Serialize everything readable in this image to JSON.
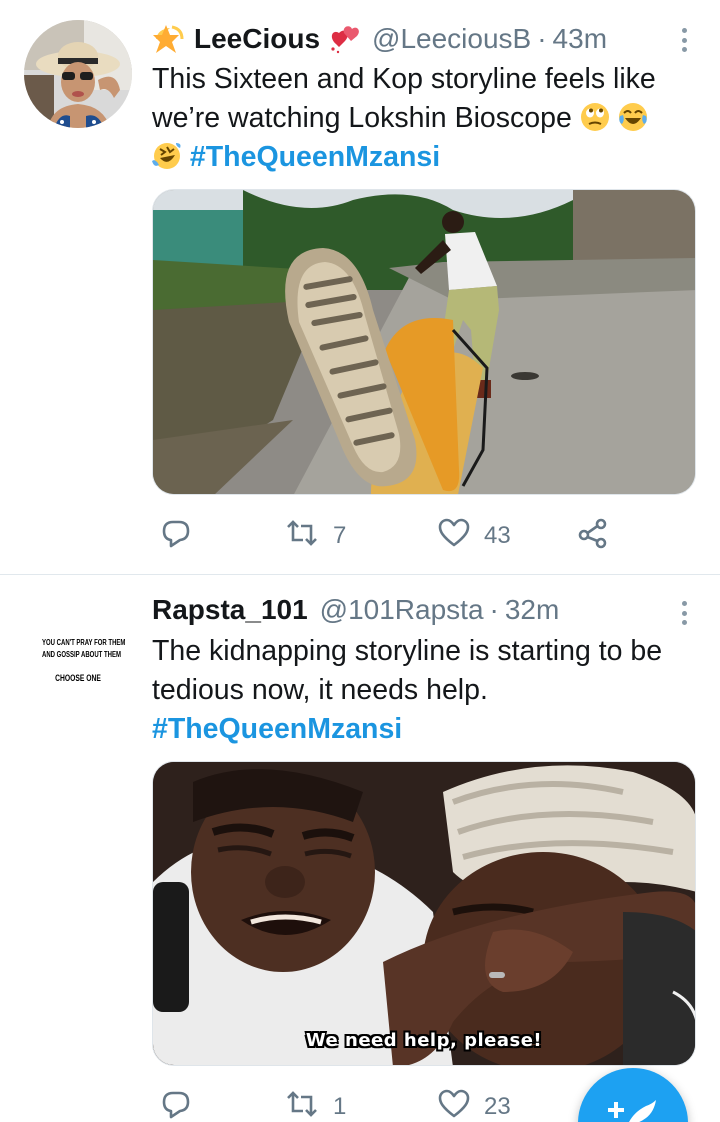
{
  "tweets": [
    {
      "name": "LeeCious",
      "handle": "@LeeciousB",
      "separator": "·",
      "time": "43m",
      "name_prefix_icon": "sparkle-star-emoji-icon",
      "name_suffix_icon": "double-heart-emoji-icon",
      "text_line_1": "This Sixteen and Kop storyline feels like",
      "text_line_2": "we’re watching Lokshin Bioscope",
      "hashtag": "#TheQueenMzansi",
      "inline_emojis": [
        "rolling-eyes-emoji-icon",
        "tears-of-joy-emoji-icon",
        "rofl-emoji-icon"
      ],
      "media_description_icon": "boot-kick-photo",
      "retweets": "7",
      "likes": "43"
    },
    {
      "name": "Rapsta_101",
      "handle": "@101Rapsta",
      "separator": "·",
      "time": "32m",
      "avatar_text_line_1": "YOU CAN'T PRAY FOR THEM",
      "avatar_text_line_2": "AND GOSSIP ABOUT THEM",
      "avatar_text_line_3": "CHOOSE ONE",
      "text_line_1": "The kidnapping storyline is starting to be",
      "text_line_2": "tedious now, it needs help.",
      "hashtag": "#TheQueenMzansi",
      "media_caption": "We need help, please!",
      "retweets": "1",
      "likes": "23"
    }
  ],
  "icons": {
    "reply": "reply-icon",
    "retweet": "retweet-icon",
    "like": "heart-icon",
    "share": "share-icon",
    "more": "more-vertical-icon",
    "compose": "compose-tweet-icon"
  },
  "colors": {
    "link": "#1b95e0",
    "secondary_text": "#657786",
    "fab": "#1da1f2",
    "divider": "#e1e8ed"
  }
}
